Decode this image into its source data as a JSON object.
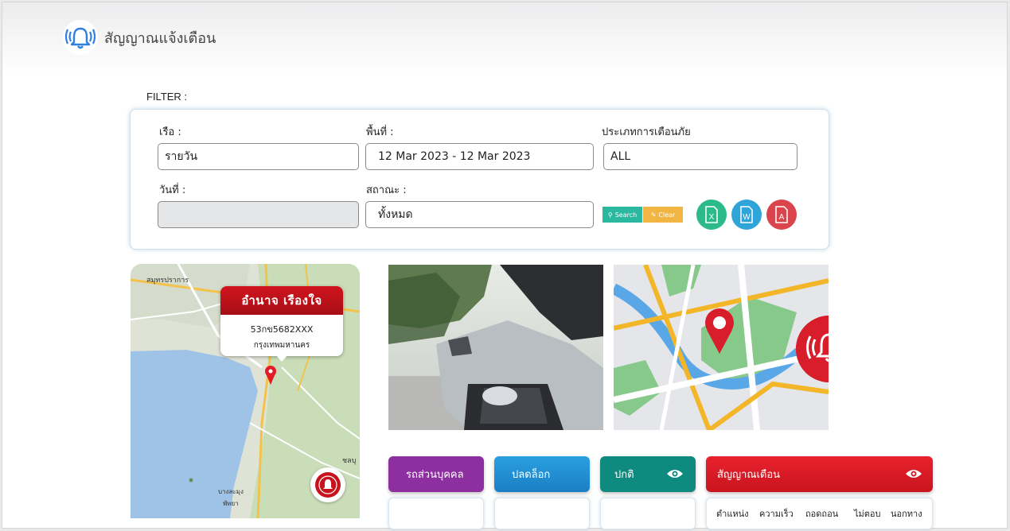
{
  "header": {
    "title": "สัญญาณแจ้งเตือน",
    "logo_icon": "bell-ringing-icon"
  },
  "filter": {
    "section_label": "FILTER :",
    "boat_label": "เรือ :",
    "boat_value": "รายวัน",
    "area_label": "พื้นที่ :",
    "area_value": "12 Mar 2023 - 12 Mar 2023",
    "alert_type_label": "ประเภทการเตือนภัย",
    "alert_type_value": "ALL",
    "date_label": "วันที่ :",
    "date_value": "",
    "status_label": "สถาณะ :",
    "status_value": "ทั้งหมด",
    "search_label": "Search",
    "clear_label": "Clear",
    "excel_label": "X",
    "word_label": "W",
    "pdf_label": "A"
  },
  "map_popup": {
    "title": "อำนาจ  เรืองใจ",
    "plate": "53กข5682XXX",
    "province": "กรุงเทพมหานคร"
  },
  "map_labels": {
    "city": "สมุทรปราการ",
    "place1": "ชลบุ",
    "place2": "บางละมุง",
    "place3": "พัทยา"
  },
  "categories": [
    {
      "label": "รถส่วนบุคคล",
      "color": "#8e2f9f"
    },
    {
      "label": "ปลดล็อก",
      "color": "#1f8fd4"
    },
    {
      "label": "ปกติ",
      "color": "#0f8a7e"
    },
    {
      "label": "สัญญาณเตือน",
      "color": "#d31a26"
    }
  ],
  "table_columns": [
    "ตำแหน่ง",
    "ความเร็ว",
    "ถอดถอน",
    "ไม่ตอบ",
    "นอกทาง"
  ],
  "colors": {
    "excel": "#2dba8a",
    "word": "#2ea4d8",
    "pdf": "#d9444d",
    "search": "#2ab8a0",
    "clear": "#f2b544",
    "accent_red": "#d31a26"
  }
}
